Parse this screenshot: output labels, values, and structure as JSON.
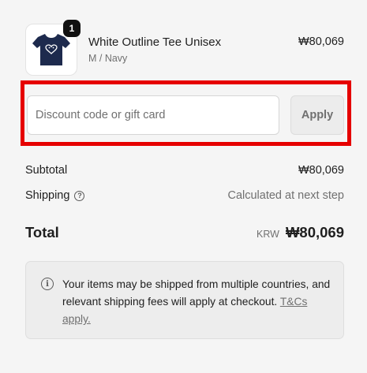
{
  "line_item": {
    "quantity": "1",
    "name": "White Outline Tee Unisex",
    "variant": "M / Navy",
    "price": "₩80,069",
    "image_icon": "navy-tshirt-heart-icon"
  },
  "discount": {
    "placeholder": "Discount code or gift card",
    "value": "",
    "apply_label": "Apply"
  },
  "summary": {
    "subtotal_label": "Subtotal",
    "subtotal_value": "₩80,069",
    "shipping_label": "Shipping",
    "shipping_value": "Calculated at next step",
    "total_label": "Total",
    "currency": "KRW",
    "total_value": "₩80,069"
  },
  "notice": {
    "text": "Your items may be shipped from multiple countries, and relevant shipping fees will apply at checkout.",
    "link_label": "T&Cs apply."
  },
  "colors": {
    "highlight": "#e60000",
    "tee": "#1d2a4d",
    "background": "#f5f5f5"
  }
}
